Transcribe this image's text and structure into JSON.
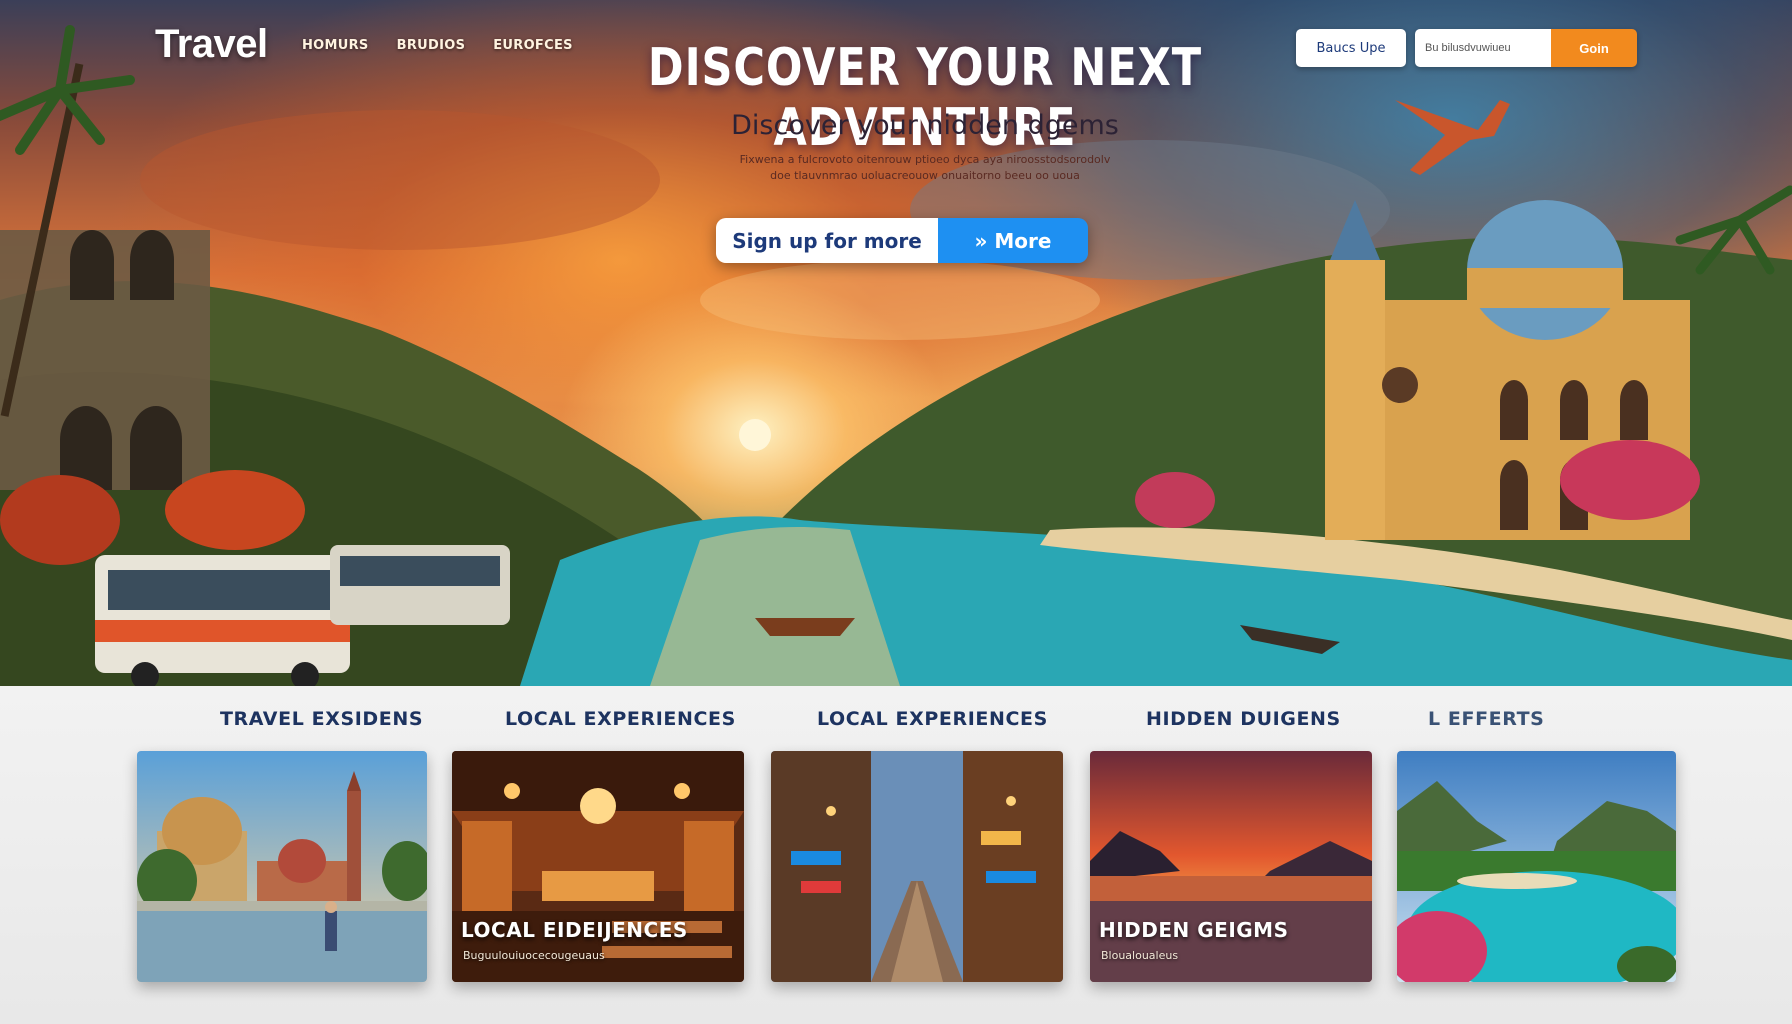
{
  "brand": "Travel",
  "nav": [
    {
      "label": "HOMURS"
    },
    {
      "label": "BRUDIOS"
    },
    {
      "label": "EUROFCES"
    }
  ],
  "hero": {
    "headline": "DISCOVER YOUR NEXT ADVENTURE",
    "subheadline": "Discover your nidden dgems",
    "body_line1": "Fixwena a fulcrovoto oitenrouw ptioeo dyca aya niroosstodsorodolv",
    "body_line2": "doe tlauvnmrao uoluacreouow onuaitorno beeu oo uoua",
    "cta_primary": "Sign up for more",
    "cta_secondary": "» More"
  },
  "header_actions": {
    "signup_label": "Baucs Upe",
    "search_placeholder": "Bu bilusdvuwiueu",
    "search_button": "Goin"
  },
  "categories": [
    {
      "label": "TRAVEL EXSIDENS",
      "overlay_title": "",
      "overlay_sub": ""
    },
    {
      "label": "LOCAL EXPERIENCES",
      "overlay_title": "LOCAL EIDEIJENCES",
      "overlay_sub": "Buguulouiuocecougeuaus"
    },
    {
      "label": "LOCAL EXPERIENCES",
      "overlay_title": "",
      "overlay_sub": ""
    },
    {
      "label": "HIDDEN DUIGENS",
      "overlay_title": "HIDDEN GEIGMS",
      "overlay_sub": "Bloualoualeus"
    },
    {
      "label": "L EFFERTS",
      "overlay_title": "",
      "overlay_sub": ""
    }
  ],
  "colors": {
    "accent_orange": "#f28a1e",
    "accent_blue": "#1e90f2",
    "heading_navy": "#1d3360"
  }
}
